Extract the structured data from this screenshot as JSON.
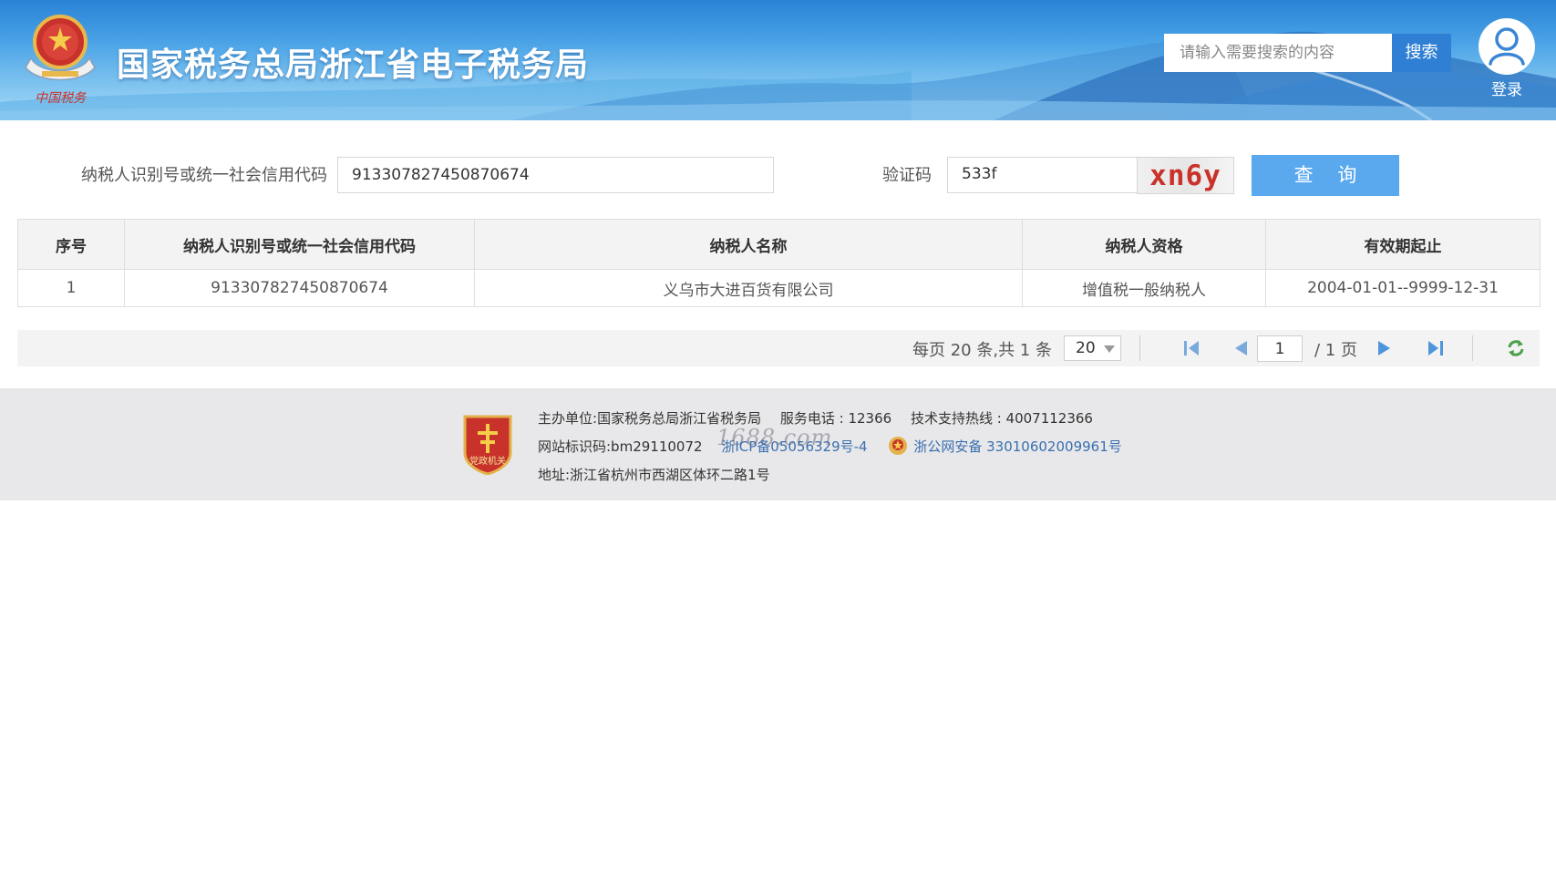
{
  "header": {
    "emblem_text": "中国税务",
    "title": "国家税务总局浙江省电子税务局",
    "search_placeholder": "请输入需要搜索的内容",
    "search_button": "搜索",
    "login_label": "登录"
  },
  "query": {
    "taxpayer_id_label": "纳税人识别号或统一社会信用代码",
    "taxpayer_id_value": "913307827450870674",
    "captcha_label": "验证码",
    "captcha_value": "533f",
    "captcha_image_text": "xn6y",
    "query_button": "查 询"
  },
  "table": {
    "headers": [
      "序号",
      "纳税人识别号或统一社会信用代码",
      "纳税人名称",
      "纳税人资格",
      "有效期起止"
    ],
    "rows": [
      [
        "1",
        "913307827450870674",
        "义乌市大进百货有限公司",
        "增值税一般纳税人",
        "2004-01-01--9999-12-31"
      ]
    ]
  },
  "pager": {
    "info": "每页 20 条,共 1 条",
    "page_size": "20",
    "current_page": "1",
    "total_pages": "/ 1 页"
  },
  "footer": {
    "host_label": "主办单位:",
    "host_value": "国家税务总局浙江省税务局",
    "phone": "服务电话 : 12366",
    "hotline": "技术支持热线 : 4007112366",
    "site_code": "网站标识码:bm29110072",
    "icp": "浙ICP备05056329号-4",
    "police": "浙公网安备 33010602009961号",
    "address": "地址:浙江省杭州市西湖区体环二路1号",
    "badge_text": "党政机关",
    "watermark": "1688.com"
  },
  "colors": {
    "header_blue": "#2a82d6",
    "search_button": "#2f7fd4",
    "query_button": "#5aa9ee",
    "captcha_red": "#c8322a",
    "footer_bg": "#e8e8ea",
    "link_blue": "#3a6fb0"
  }
}
